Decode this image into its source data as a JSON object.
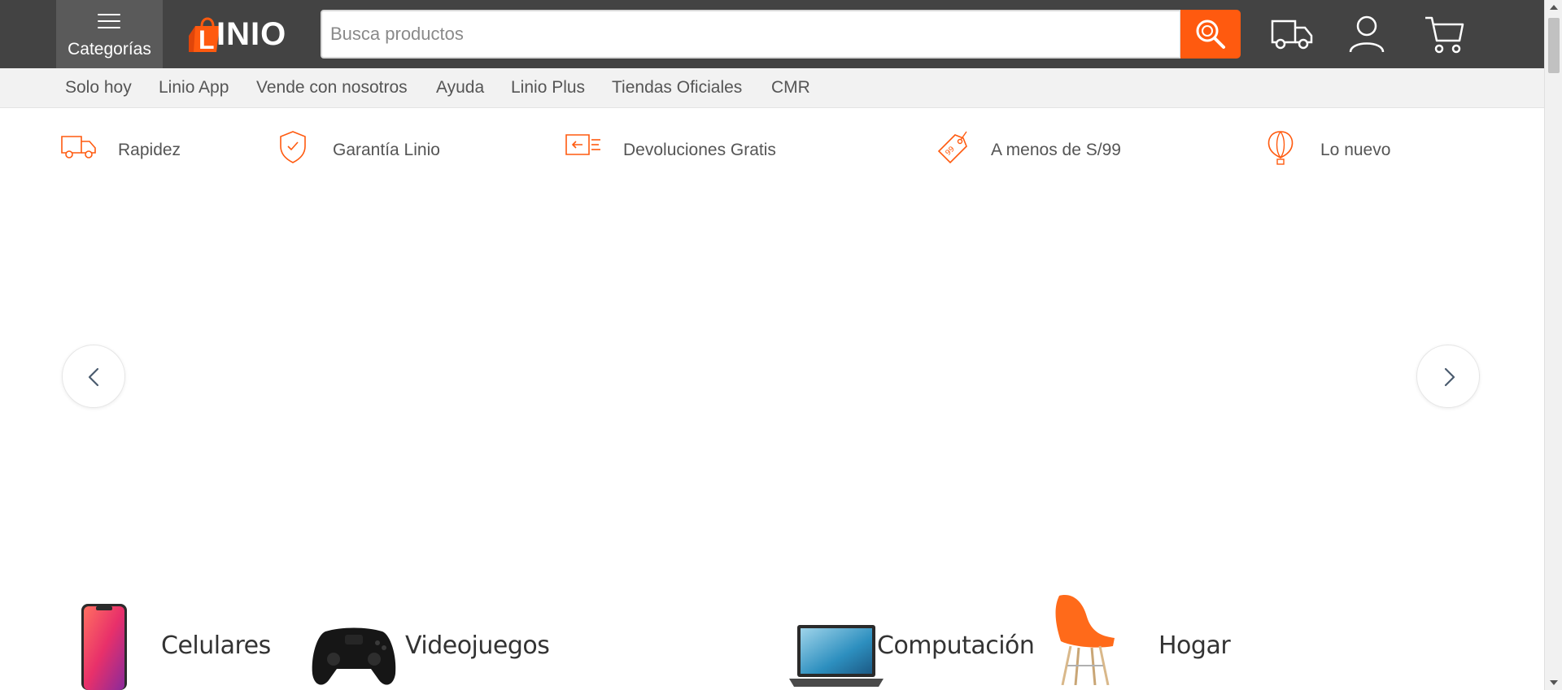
{
  "header": {
    "categories_label": "Categorías",
    "logo_text": "LINIO",
    "search_placeholder": "Busca productos",
    "search_value": "",
    "icons": [
      "truck-icon",
      "user-icon",
      "cart-icon"
    ]
  },
  "subnav": {
    "items": [
      "Solo hoy",
      "Linio App",
      "Vende con nosotros",
      "Ayuda",
      "Linio Plus",
      "Tiendas Oficiales",
      "CMR"
    ]
  },
  "benefits": [
    {
      "label": "Rapidez",
      "icon": "truck-icon"
    },
    {
      "label": "Garantía Linio",
      "icon": "shield-icon"
    },
    {
      "label": "Devoluciones Gratis",
      "icon": "return-box-icon"
    },
    {
      "label": "A menos de S/99",
      "icon": "price-tag-icon"
    },
    {
      "label": "Lo nuevo",
      "icon": "balloon-icon"
    }
  ],
  "categories": [
    {
      "label": "Celulares",
      "icon": "phone-image"
    },
    {
      "label": "Videojuegos",
      "icon": "gamepad-image"
    },
    {
      "label": "Computación",
      "icon": "laptop-image"
    },
    {
      "label": "Hogar",
      "icon": "chair-image"
    }
  ],
  "colors": {
    "brand_orange": "#ff5a0f",
    "header_bg": "#434343",
    "subnav_bg": "#f2f2f2"
  }
}
